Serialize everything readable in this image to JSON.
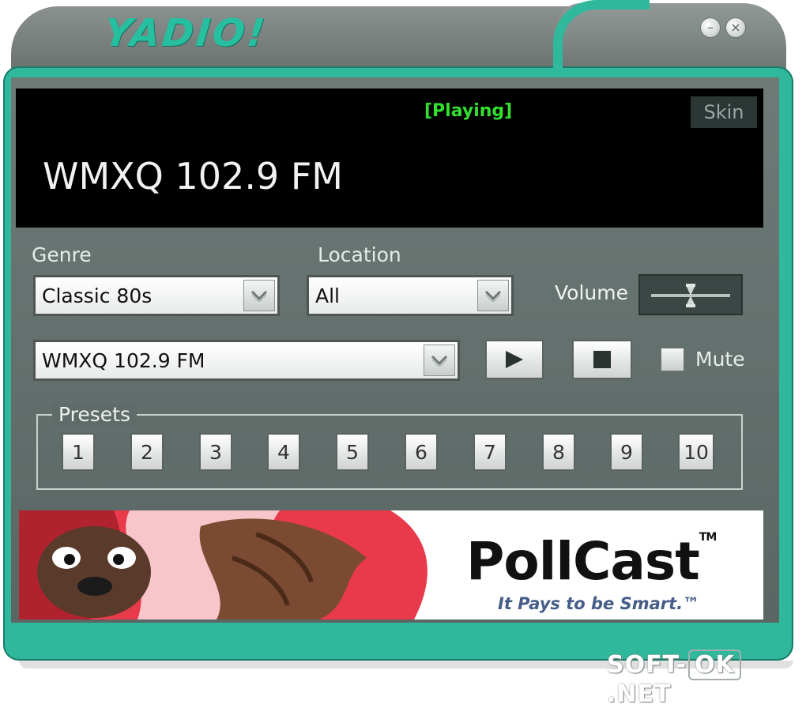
{
  "window": {
    "logo_text": "YADIO!",
    "minimize_label": "–",
    "close_label": "×"
  },
  "display": {
    "status": "[Playing]",
    "skin_button": "Skin",
    "current_station": "WMXQ 102.9 FM"
  },
  "filters": {
    "genre_label": "Genre",
    "genre_value": "Classic 80s",
    "location_label": "Location",
    "location_value": "All",
    "volume_label": "Volume",
    "volume_level": 0.5
  },
  "station_select": {
    "value": "WMXQ 102.9 FM"
  },
  "transport": {
    "play_icon": "play-icon",
    "stop_icon": "stop-icon",
    "mute_label": "Mute",
    "mute_checked": false
  },
  "presets": {
    "title": "Presets",
    "buttons": [
      "1",
      "2",
      "3",
      "4",
      "5",
      "6",
      "7",
      "8",
      "9",
      "10"
    ]
  },
  "ad_banner": {
    "brand": "PollCast",
    "trademark": "TM",
    "tagline": "It Pays to be Smart.™"
  },
  "watermark": {
    "left": "SOFT-",
    "middle": "OK",
    "right": ".NET"
  },
  "colors": {
    "accent_teal": "#2fb89c",
    "status_green": "#33e02f",
    "panel_gray": "#5f6b68"
  }
}
